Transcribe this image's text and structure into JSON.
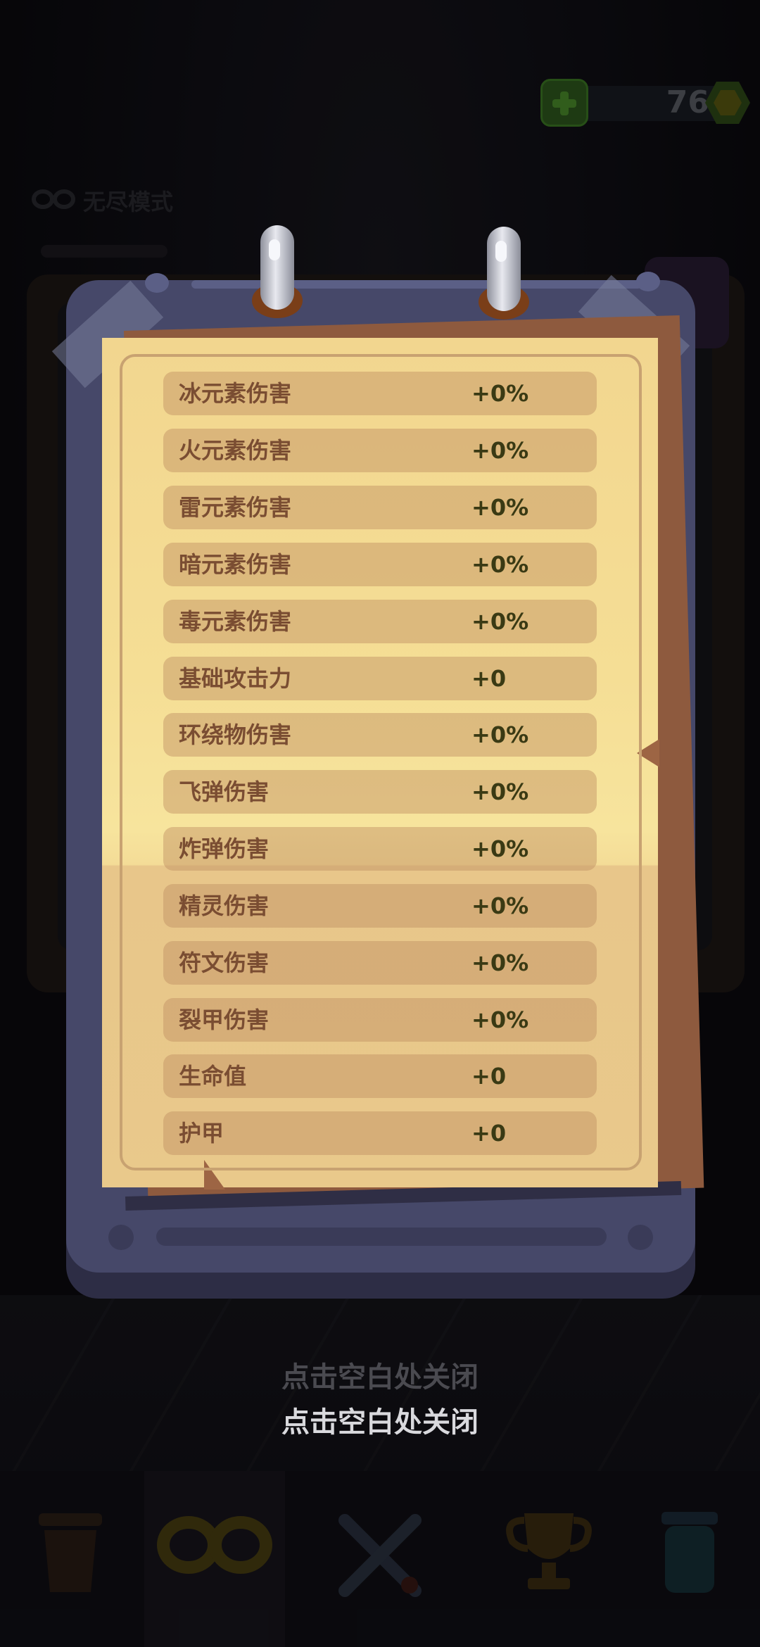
{
  "hud": {
    "currency_value": "76"
  },
  "background": {
    "mode_label": "无尽模式"
  },
  "stats": [
    {
      "name": "冰元素伤害",
      "value": "+0%"
    },
    {
      "name": "火元素伤害",
      "value": "+0%"
    },
    {
      "name": "雷元素伤害",
      "value": "+0%"
    },
    {
      "name": "暗元素伤害",
      "value": "+0%"
    },
    {
      "name": "毒元素伤害",
      "value": "+0%"
    },
    {
      "name": "基础攻击力",
      "value": "+0"
    },
    {
      "name": "环绕物伤害",
      "value": "+0%"
    },
    {
      "name": "飞弹伤害",
      "value": "+0%"
    },
    {
      "name": "炸弹伤害",
      "value": "+0%"
    },
    {
      "name": "精灵伤害",
      "value": "+0%"
    },
    {
      "name": "符文伤害",
      "value": "+0%"
    },
    {
      "name": "裂甲伤害",
      "value": "+0%"
    },
    {
      "name": "生命值",
      "value": "+0"
    },
    {
      "name": "护甲",
      "value": "+0"
    }
  ],
  "close_hint": "点击空白处关闭",
  "close_hint_echo": "点击空白处关闭",
  "bottom_nav": [
    {
      "icon": "bin-icon"
    },
    {
      "icon": "infinity-icon"
    },
    {
      "icon": "swords-icon"
    },
    {
      "icon": "trophy-icon"
    },
    {
      "icon": "potion-icon"
    }
  ]
}
